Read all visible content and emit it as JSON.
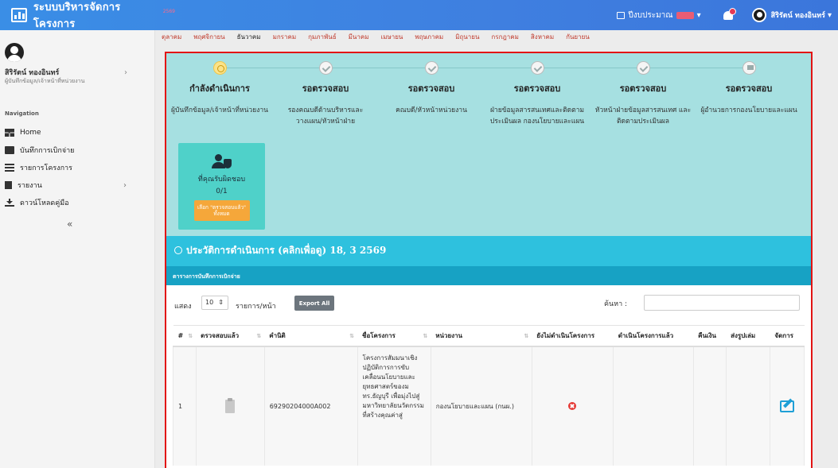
{
  "app": {
    "title": "ระบบบริหารจัดการโครงการ",
    "title_badge": "2569",
    "budget_label": "ปีงบประมาณ",
    "budget_year": "2569",
    "user_name": "สิริรัตน์ ทองอินทร์"
  },
  "sidebar": {
    "user_name": "สิริรัตน์ ทองอินทร์",
    "user_role": "ผู้บันทึกข้อมูล/เจ้าหน้าที่หน่วยงาน",
    "nav_heading": "Navigation",
    "items": [
      {
        "label": "Home",
        "icon": "home-icon"
      },
      {
        "label": "บันทึกการเบิกจ่าย",
        "icon": "note-icon"
      },
      {
        "label": "รายการโครงการ",
        "icon": "list-icon"
      },
      {
        "label": "รายงาน",
        "icon": "file-icon"
      },
      {
        "label": "ดาวน์โหลดคู่มือ",
        "icon": "download-icon"
      }
    ],
    "collapse": "«"
  },
  "months": [
    "ตุลาคม",
    "พฤศจิกายน",
    "ธันวาคม",
    "มกราคม",
    "กุมภาพันธ์",
    "มีนาคม",
    "เมษายน",
    "พฤษภาคม",
    "มิถุนายน",
    "กรกฎาคม",
    "สิงหาคม",
    "กันยายน"
  ],
  "active_month": "ธันวาคม",
  "steps": [
    {
      "status": "กำลังดำเนินการ",
      "desc": "ผู้บันทึกข้อมูล/เจ้าหน้าที่หน่วยงาน"
    },
    {
      "status": "รอตรวจสอบ",
      "desc": "รองคณบดีด้านบริหารและวางแผน/หัวหน้าฝ่าย"
    },
    {
      "status": "รอตรวจสอบ",
      "desc": "คณบดี/หัวหน้าหน่วยงาน"
    },
    {
      "status": "รอตรวจสอบ",
      "desc": "ฝ่ายข้อมูลสารสนเทศและติดตามประเมินผล กองนโยบายและแผน"
    },
    {
      "status": "รอตรวจสอบ",
      "desc": "หัวหน้าฝ่ายข้อมูลสารสนเทศ และติดตามประเมินผล"
    },
    {
      "status": "รอตรวจสอบ",
      "desc": "ผู้อำนวยการกองนโยบายและแผน"
    }
  ],
  "responsible": {
    "label": "ที่คุณรับผิดชอบ",
    "count": "0/1",
    "button": "เลือก \"ตรวจสอบแล้ว\" ทั้งหมด"
  },
  "history": {
    "title": "ประวัติการดำเนินการ (คลิกเพื่อดู) 18, 3 2569"
  },
  "table_title": "ตารางการบันทึกการเบิกจ่าย",
  "controls": {
    "show_label": "แสดง",
    "page_len": "10",
    "per_page": "รายการ/หน้า",
    "export": "Export All",
    "search_label": "ค้นหา :",
    "search_placeholder": ""
  },
  "table": {
    "headers": [
      "#",
      "ตรวจสอบแล้ว",
      "คำนิติ",
      "ชื่อโครงการ",
      "หน่วยงาน",
      "ยังไม่ดำเนินโครงการ",
      "ดำเนินโครงการแล้ว",
      "คืนเงิน",
      "ส่งรูปเล่ม",
      "จัดการ"
    ],
    "rows": [
      {
        "no": "1",
        "code": "69290204000A002",
        "project": "โครงการสัมมนาเชิงปฏิบัติการการขับเคลื่อนนโยบายและยุทธศาสตร์ของมทร.ธัญบุรี เพื่อมุ่งไปสู่มหาวิทยาลัยนวัตกรรมที่สร้างคุณค่าสู่",
        "unit": "กองนโยบายและแผน (กนผ.)"
      }
    ]
  },
  "colors": {
    "topbar": "#3a8ee6",
    "steps_bg": "#a6e0e1",
    "history_bg": "#2ec1de",
    "subhead_bg": "#17a2c4",
    "frame_border": "#e21414",
    "card_bg": "#4fd1c9",
    "button_orange": "#f5a73a"
  }
}
